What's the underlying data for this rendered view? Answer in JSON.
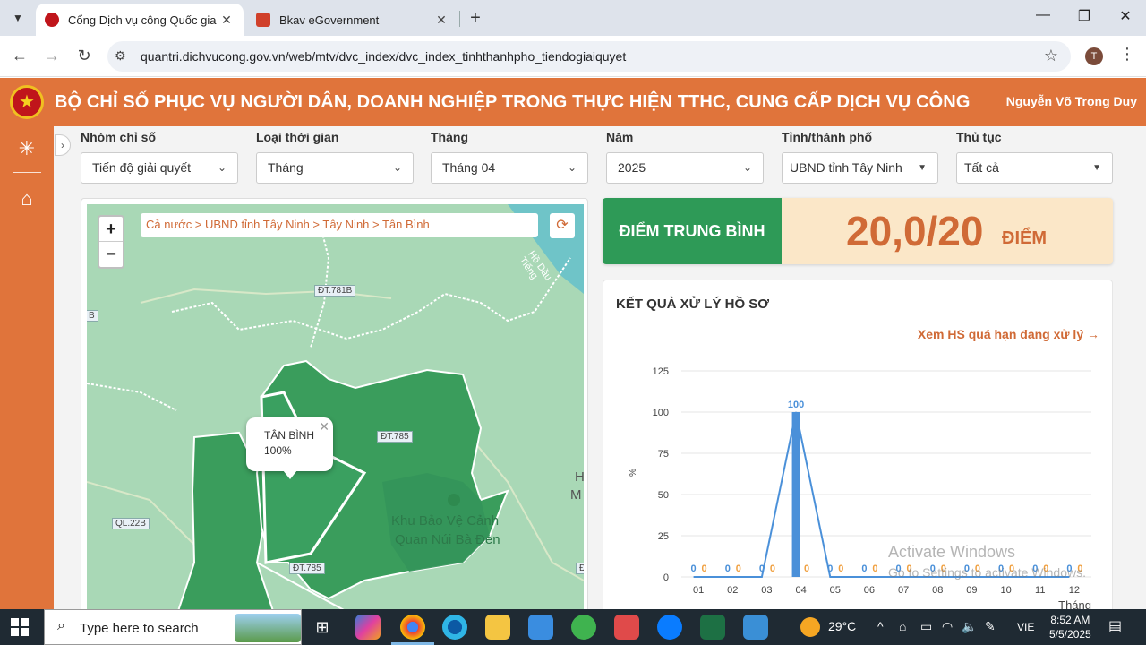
{
  "browser": {
    "tabs": [
      {
        "title": "Cổng Dịch vụ công Quốc gia",
        "active": true,
        "favicon_color": "#c0151b"
      },
      {
        "title": "Bkav eGovernment",
        "active": false,
        "favicon_color": "#d0402a"
      }
    ],
    "url": "quantri.dichvucong.gov.vn/web/mtv/dvc_index/dvc_index_tinhthanhpho_tiendogiaiquyet",
    "profile_initial": "T"
  },
  "header": {
    "title": "BỘ CHỈ SỐ PHỤC VỤ NGƯỜI DÂN, DOANH NGHIỆP TRONG THỰC HIỆN TTHC, CUNG CẤP DỊCH VỤ CÔNG",
    "user": "Nguyễn Võ Trọng Duy",
    "accent": "#e0743b"
  },
  "filters": [
    {
      "label": "Nhóm chỉ số",
      "value": "Tiến độ giải quyết"
    },
    {
      "label": "Loại thời gian",
      "value": "Tháng"
    },
    {
      "label": "Tháng",
      "value": "Tháng 04"
    },
    {
      "label": "Năm",
      "value": "2025"
    },
    {
      "label": "Tỉnh/thành phố",
      "value": "UBND tỉnh Tây Ninh"
    },
    {
      "label": "Thủ tục",
      "value": "Tất cả"
    }
  ],
  "map": {
    "breadcrumb": "Cả nước > UBND tỉnh Tây Ninh > Tây Ninh > Tân Bình",
    "popup_name": "TÂN BÌNH",
    "popup_value": "100%",
    "labels": [
      "ĐT.781B",
      "ĐT.785",
      "ĐT.785",
      "QL.22B",
      "Khu Bảo Vệ Cảnh",
      "Quan Núi Bà Đen",
      "Hồ Dầu Tiếng",
      "H",
      "M",
      "B",
      "Đ"
    ]
  },
  "score": {
    "label": "ĐIỂM TRUNG BÌNH",
    "value": "20,0/20",
    "unit": "ĐIỂM"
  },
  "result": {
    "title": "KẾT QUẢ XỬ LÝ HỒ SƠ",
    "overdue_link": "Xem HS quá hạn đang xử lý →"
  },
  "chart_data": {
    "type": "bar",
    "categories": [
      "01",
      "02",
      "03",
      "04",
      "05",
      "06",
      "07",
      "08",
      "09",
      "10",
      "11",
      "12"
    ],
    "series": [
      {
        "values": [
          0,
          0,
          0,
          100,
          0,
          0,
          0,
          0,
          0,
          0,
          0,
          0
        ],
        "color": "#4a90d9"
      },
      {
        "values": [
          0,
          0,
          0,
          0,
          0,
          0,
          0,
          0,
          0,
          0,
          0,
          0
        ],
        "color": "#f0a040"
      }
    ],
    "line_values": [
      0,
      0,
      0,
      100,
      0,
      0,
      0,
      0,
      0,
      0,
      0,
      0
    ],
    "ylim": [
      0,
      125
    ],
    "yticks": [
      0,
      25,
      50,
      75,
      100,
      125
    ],
    "ylabel": "%",
    "xlabel": "Tháng",
    "grid": true
  },
  "watermark": {
    "line1": "Activate Windows",
    "line2": "Go to Settings to activate Windows."
  },
  "taskbar": {
    "search_placeholder": "Type here to search",
    "weather": "29°C",
    "language": "VIE",
    "time": "8:52 AM",
    "date": "5/5/2025"
  }
}
